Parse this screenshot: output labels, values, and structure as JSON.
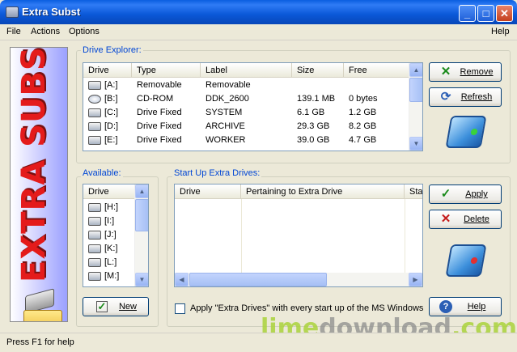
{
  "window": {
    "title": "Extra Subst"
  },
  "menu": {
    "file": "File",
    "actions": "Actions",
    "options": "Options",
    "help": "Help"
  },
  "banner": {
    "text": "EXTRA SUBST"
  },
  "drive_explorer": {
    "label": "Drive Explorer:",
    "columns": [
      "Drive",
      "Type",
      "Label",
      "Size",
      "Free"
    ],
    "rows": [
      {
        "drive": "[A:]",
        "type": "Removable",
        "label": "Removable",
        "size": "",
        "free": ""
      },
      {
        "drive": "[B:]",
        "type": "CD-ROM",
        "label": "DDK_2600",
        "size": "139.1 MB",
        "free": "0 bytes"
      },
      {
        "drive": "[C:]",
        "type": "Drive Fixed",
        "label": "SYSTEM",
        "size": "6.1 GB",
        "free": "1.2 GB"
      },
      {
        "drive": "[D:]",
        "type": "Drive Fixed",
        "label": "ARCHIVE",
        "size": "29.3 GB",
        "free": "8.2 GB"
      },
      {
        "drive": "[E:]",
        "type": "Drive Fixed",
        "label": "WORKER",
        "size": "39.0 GB",
        "free": "4.7 GB"
      }
    ],
    "remove_label": "Remove",
    "refresh_label": "Refresh"
  },
  "available": {
    "label": "Available:",
    "column": "Drive",
    "items": [
      "[H:]",
      "[I:]",
      "[J:]",
      "[K:]",
      "[L:]",
      "[M:]"
    ],
    "new_label": "New"
  },
  "startup": {
    "label": "Start Up Extra Drives:",
    "columns": [
      "Drive",
      "Pertaining to Extra Drive",
      "Sta"
    ],
    "apply_label": "Apply",
    "delete_label": "Delete",
    "help_label": "Help",
    "checkbox_label": "Apply \"Extra Drives\" with every start up of the MS Windows"
  },
  "status": {
    "text": "Press F1 for help"
  },
  "watermark": {
    "part1": "lime",
    "part2": "download",
    "part3": ".com"
  },
  "colors": {
    "title_bar": "#0a5ee0",
    "group_label": "#0046d5",
    "remove_icon": "#1a8a1a",
    "delete_icon": "#c41a1a",
    "apply_icon": "#1a8a1a"
  }
}
